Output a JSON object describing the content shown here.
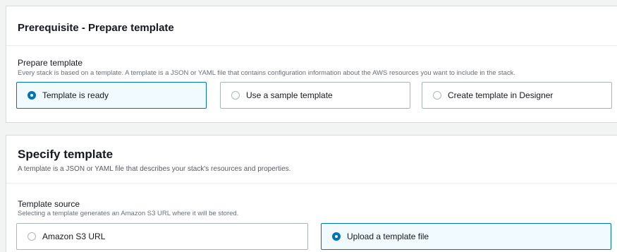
{
  "prerequisite": {
    "title": "Prerequisite - Prepare template",
    "field_label": "Prepare template",
    "field_desc": "Every stack is based on a template. A template is a JSON or YAML file that contains configuration information about the AWS resources you want to include in the stack.",
    "options": [
      {
        "label": "Template is ready",
        "selected": true
      },
      {
        "label": "Use a sample template",
        "selected": false
      },
      {
        "label": "Create template in Designer",
        "selected": false
      }
    ]
  },
  "specify": {
    "title": "Specify template",
    "desc": "A template is a JSON or YAML file that describes your stack's resources and properties.",
    "field_label": "Template source",
    "field_desc": "Selecting a template generates an Amazon S3 URL where it will be stored.",
    "options": [
      {
        "label": "Amazon S3 URL",
        "selected": false
      },
      {
        "label": "Upload a template file",
        "selected": true
      }
    ]
  },
  "colors": {
    "accent": "#0073bb",
    "selected_bg": "#f1faff",
    "border": "#aab7b8",
    "page_bg": "#f2f3f3"
  }
}
